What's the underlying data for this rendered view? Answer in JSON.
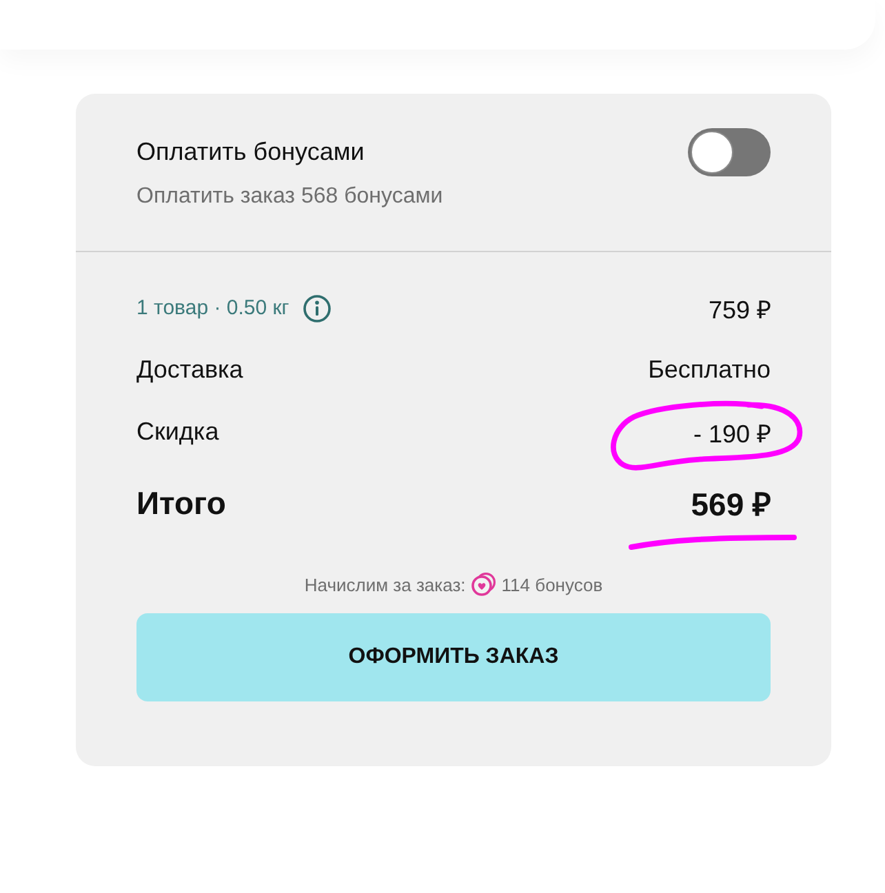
{
  "bonus_payment": {
    "title": "Оплатить бонусами",
    "subtitle": "Оплатить заказ 568 бонусами",
    "on": false
  },
  "summary": {
    "rows": [
      {
        "kind": "items",
        "label": "1 товар · 0.50 кг",
        "value": "759 ₽",
        "circled": false,
        "underlined": false
      },
      {
        "kind": "plain",
        "label": "Доставка",
        "value": "Бесплатно",
        "circled": false,
        "underlined": false
      },
      {
        "kind": "plain",
        "label": "Скидка",
        "value": "- 190 ₽",
        "circled": true,
        "underlined": false
      },
      {
        "kind": "total",
        "label": "Итого",
        "value": "569 ₽",
        "circled": false,
        "underlined": true
      }
    ]
  },
  "bonus_accrual": {
    "label": "Начислим за заказ:",
    "amount": "114 бонусов"
  },
  "checkout_button": {
    "label": "ОФОРМИТЬ ЗАКАЗ"
  }
}
